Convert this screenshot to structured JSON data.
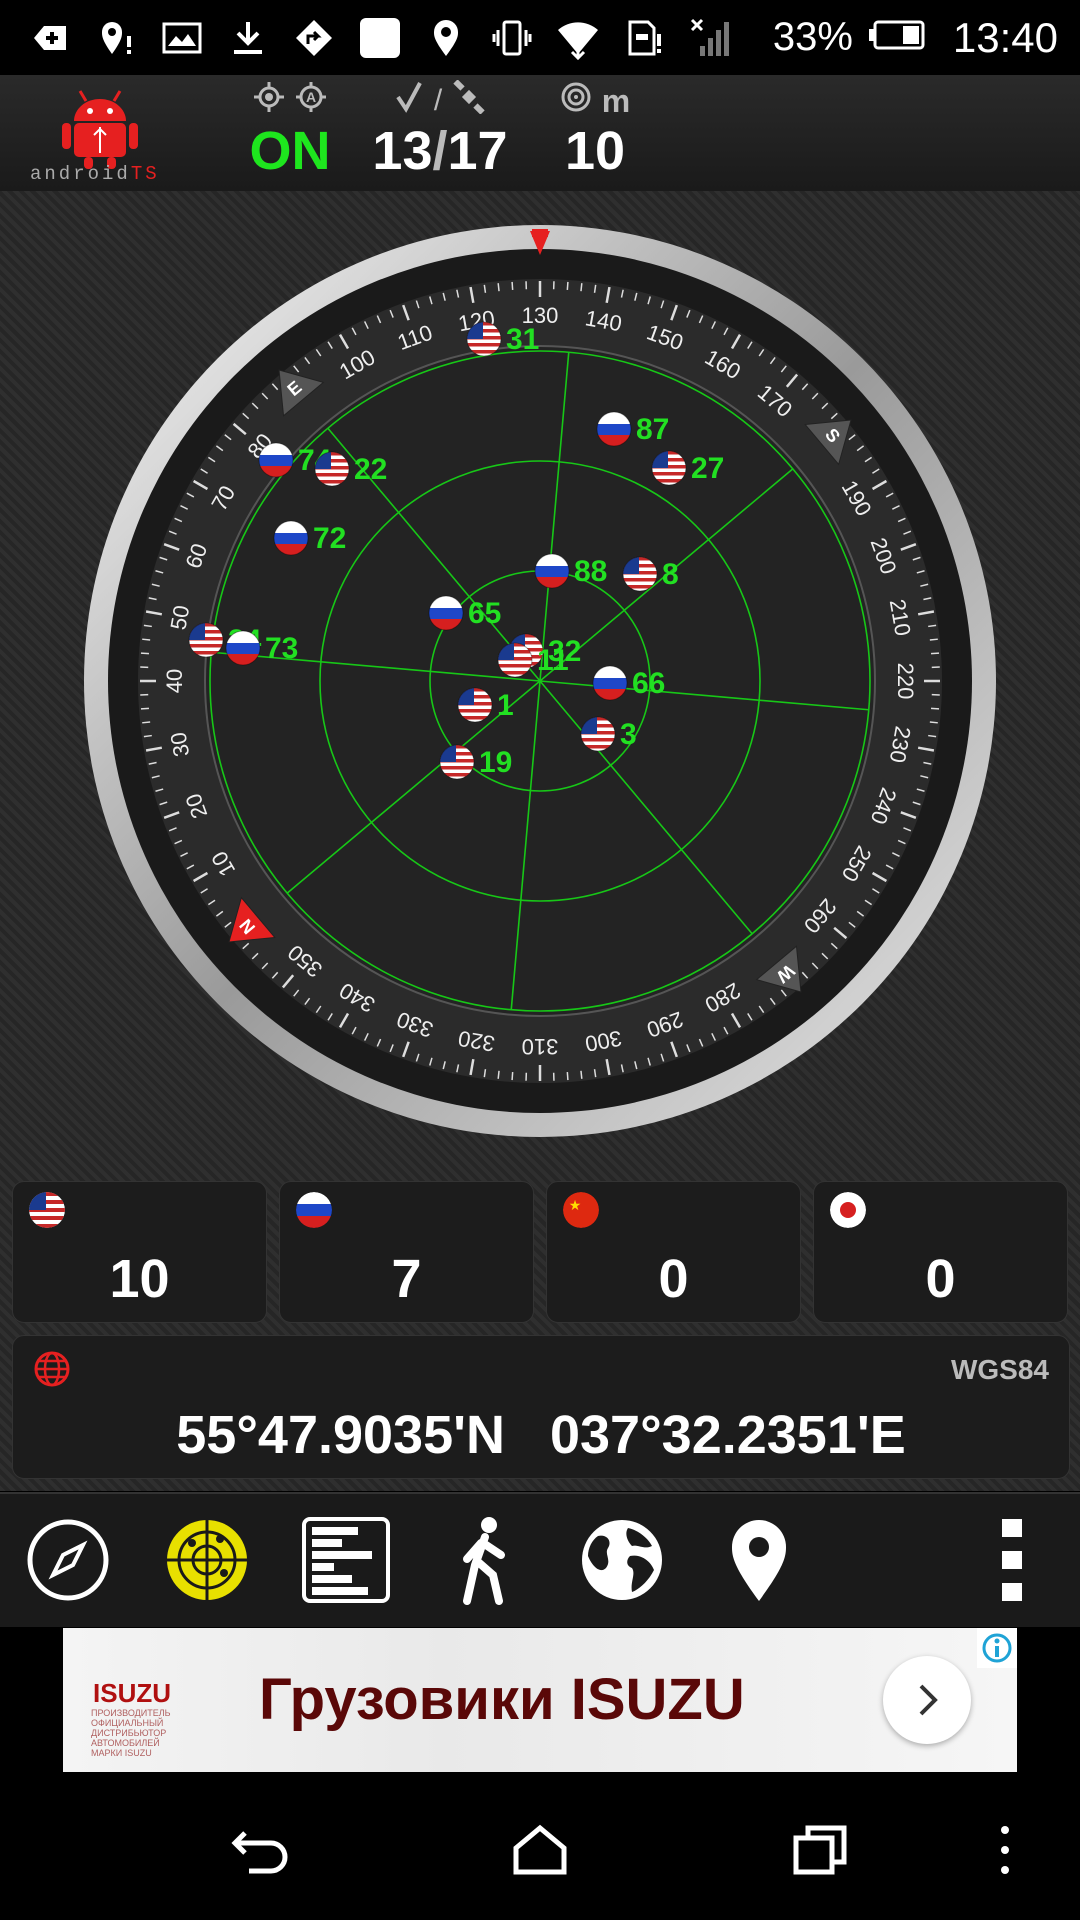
{
  "status_bar": {
    "icons": [
      "add-notification-icon",
      "location-alert-icon",
      "image-icon",
      "download-icon",
      "navigation-icon",
      "blank-square-icon",
      "location-icon",
      "vibrate-icon",
      "wifi-icon",
      "sd-card-alert-icon",
      "no-signal-icon"
    ],
    "battery_percent": "33%",
    "time": "13:40"
  },
  "top_bar": {
    "logo_text_prefix": "android",
    "logo_text_suffix": "TS",
    "fix_status": "ON",
    "satellites_used": "13",
    "slash": "/",
    "satellites_visible": "17",
    "accuracy": "10",
    "accuracy_unit": "m"
  },
  "radar": {
    "heading_deg": 130,
    "cardinals": {
      "N": "N",
      "E": "E",
      "S": "S",
      "W": "W"
    },
    "satellites": [
      {
        "id": "31",
        "system": "gps"
      },
      {
        "id": "87",
        "system": "glonass"
      },
      {
        "id": "27",
        "system": "gps"
      },
      {
        "id": "74",
        "system": "glonass"
      },
      {
        "id": "22",
        "system": "gps"
      },
      {
        "id": "72",
        "system": "glonass"
      },
      {
        "id": "88",
        "system": "glonass"
      },
      {
        "id": "8",
        "system": "gps"
      },
      {
        "id": "65",
        "system": "glonass"
      },
      {
        "id": "24",
        "system": "gps"
      },
      {
        "id": "73",
        "system": "glonass"
      },
      {
        "id": "32",
        "system": "gps"
      },
      {
        "id": "11",
        "system": "gps"
      },
      {
        "id": "66",
        "system": "glonass"
      },
      {
        "id": "1",
        "system": "gps"
      },
      {
        "id": "3",
        "system": "gps"
      },
      {
        "id": "19",
        "system": "gps"
      }
    ]
  },
  "constellation_counts": [
    {
      "system": "gps",
      "count": "10"
    },
    {
      "system": "glonass",
      "count": "7"
    },
    {
      "system": "beidou",
      "count": "0"
    },
    {
      "system": "qzss",
      "count": "0"
    }
  ],
  "coordinates": {
    "datum": "WGS84",
    "latitude": "55°47.9035'N",
    "longitude": "037°32.2351'E"
  },
  "toolbar": {
    "items": [
      "compass-icon",
      "radar-icon",
      "signal-bars-icon",
      "walk-icon",
      "globe-icon",
      "map-pin-icon",
      "more-vert-icon"
    ]
  },
  "ad": {
    "brand": "ISUZU",
    "brand_subtitle": "ПРОИЗВОДИТЕЛЬ ОФИЦИАЛЬНЫЙ ДИСТРИБЬЮТОР АВТОМОБИЛЕЙ МАРКИ ISUZU",
    "title": "Грузовики ISUZU"
  }
}
